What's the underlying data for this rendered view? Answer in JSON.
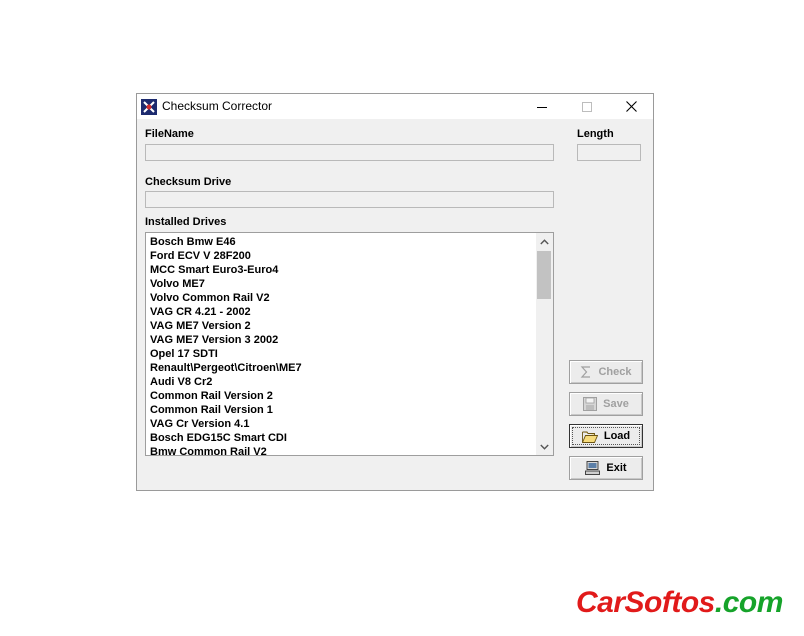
{
  "window": {
    "title": "Checksum Corrector",
    "controls": [
      "minimize-icon",
      "maximize-icon",
      "close-icon"
    ]
  },
  "form": {
    "filename_label": "FileName",
    "filename_value": "",
    "length_label": "Length",
    "length_value": "",
    "checksum_drive_label": "Checksum Drive",
    "checksum_drive_value": "",
    "installed_drives_label": "Installed Drives"
  },
  "installed_drives": [
    "Bosch Bmw E46",
    "Ford ECV V 28F200",
    "MCC Smart Euro3-Euro4",
    "Volvo ME7",
    "Volvo Common Rail V2",
    "VAG CR 4.21 - 2002",
    "VAG ME7 Version 2",
    "VAG ME7 Version 3 2002",
    "Opel 17 SDTI",
    "Renault\\Pergeot\\Citroen\\ME7",
    "Audi V8 Cr2",
    "Common Rail Version 2",
    "Common Rail Version 1",
    "VAG Cr Version 4.1",
    "Bosch EDG15C Smart CDI",
    "Bmw Common Rail V2"
  ],
  "buttons": {
    "check": {
      "label": "Check",
      "icon": "sigma-icon",
      "enabled": false
    },
    "save": {
      "label": "Save",
      "icon": "floppy-disk-icon",
      "enabled": false
    },
    "load": {
      "label": "Load",
      "icon": "open-folder-icon",
      "enabled": true
    },
    "exit": {
      "label": "Exit",
      "icon": "computer-icon",
      "enabled": true
    }
  },
  "watermark": {
    "main": "CarSoftos",
    "tld": ".com",
    "colors": {
      "main": "#e11a1a",
      "tld": "#16a32a"
    }
  }
}
